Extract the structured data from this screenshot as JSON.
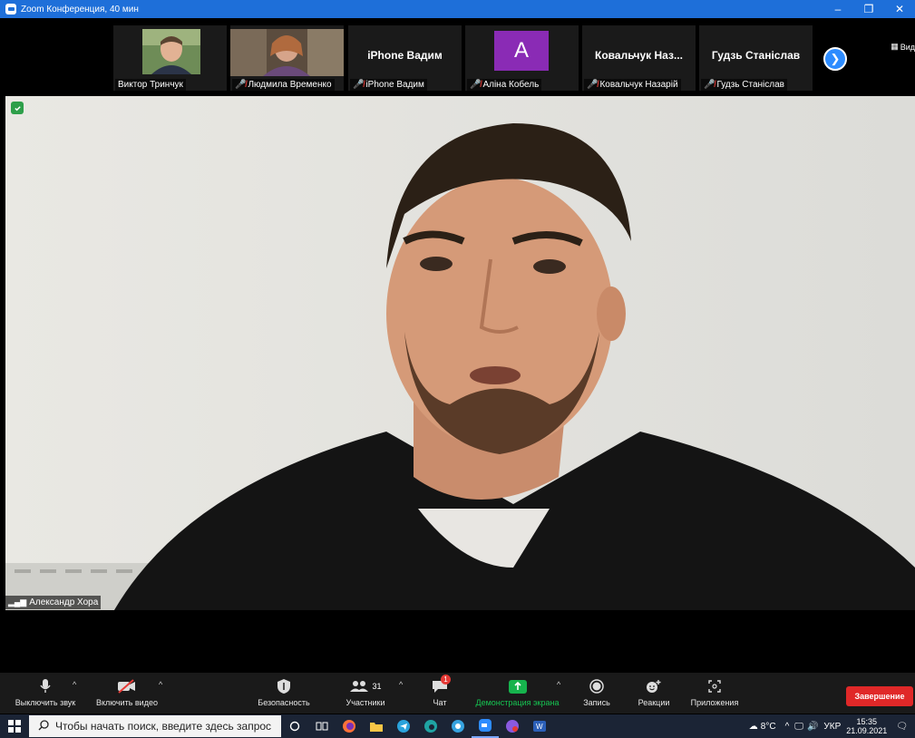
{
  "window": {
    "title": "Zoom Конференция, 40 мин",
    "controls": [
      "–",
      "❐",
      "✕"
    ]
  },
  "gallery": {
    "participants": [
      {
        "name": "Виктор Тринчук",
        "muted": false,
        "display": "photo"
      },
      {
        "name": "Людмила Времeнко",
        "muted": true,
        "display": "photo"
      },
      {
        "name": "iPhone Вадим",
        "muted": true,
        "display": "name",
        "big_name": "iPhone Вадим"
      },
      {
        "name": "Аліна Кобель",
        "muted": true,
        "display": "letter",
        "letter": "A"
      },
      {
        "name": "Ковальчук Назарій",
        "muted": true,
        "display": "name",
        "big_name": "Ковальчук Наз..."
      },
      {
        "name": "Гудзь Станіслав",
        "muted": true,
        "display": "name",
        "big_name": "Гудзь Станіслав"
      }
    ],
    "next_icon": "chevron-right-icon",
    "view_label": "Вид"
  },
  "main_video": {
    "speaker_name": "Александр Хора",
    "security_badge": "shield-check-icon"
  },
  "toolbar": {
    "mute_label": "Выключить звук",
    "video_label": "Включить видео",
    "security_label": "Безопасность",
    "participants_label": "Участники",
    "participants_count": "31",
    "chat_label": "Чат",
    "chat_badge": "1",
    "share_label": "Демонстрация экрана",
    "record_label": "Запись",
    "reactions_label": "Реакции",
    "apps_label": "Приложения",
    "end_label": "Завершение"
  },
  "taskbar": {
    "search_placeholder": "Чтобы начать поиск, введите здесь запрос",
    "weather": "8°C",
    "language": "УКР",
    "time": "15:35",
    "date": "21.09.2021",
    "apps": [
      "cortana-icon",
      "task-view-icon",
      "firefox-icon",
      "file-explorer-icon",
      "telegram-icon",
      "edge-icon",
      "chrome-icon",
      "zoom-icon",
      "viber-icon",
      "word-icon"
    ]
  },
  "colors": {
    "title_bar": "#1e6fd9",
    "accent": "#2d8cff",
    "end_button": "#e02828",
    "share_green": "#16b34d",
    "avatar_purple": "#8a2bb5"
  }
}
